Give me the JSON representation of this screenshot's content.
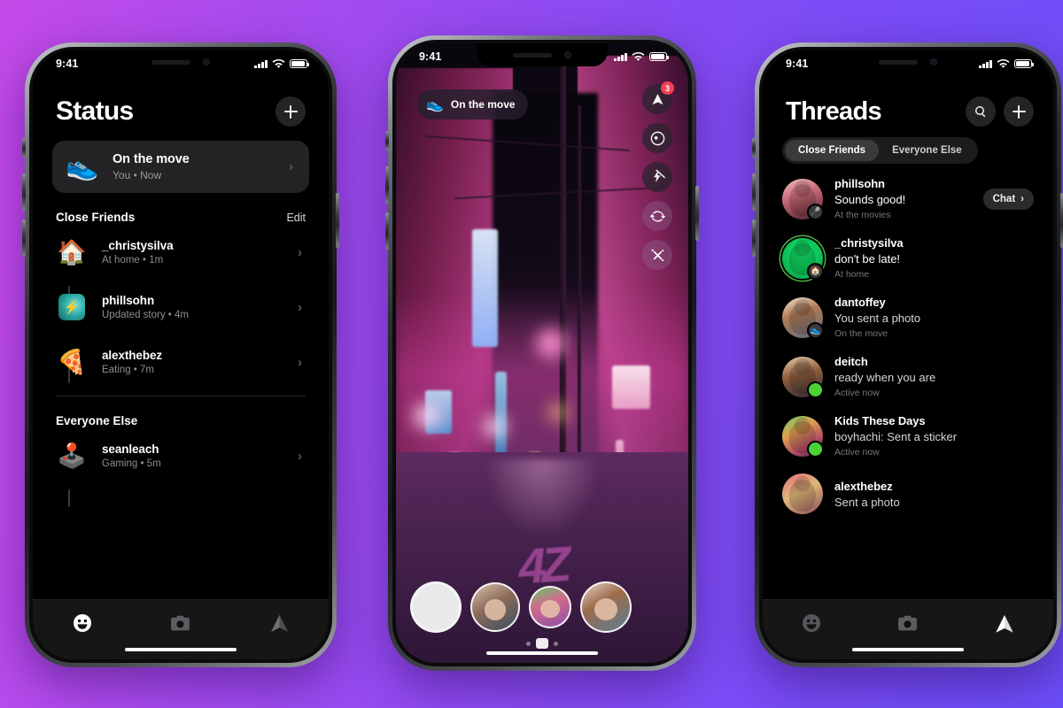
{
  "background": {
    "from": "#c44ae8",
    "to": "#6b4ef8"
  },
  "status_bar": {
    "time": "9:41"
  },
  "phone_status": {
    "title": "Status",
    "add_button": "+",
    "my_status": {
      "emoji": "👟",
      "title": "On the move",
      "subtitle": "You • Now",
      "chevron": "›"
    },
    "sections": [
      {
        "title": "Close Friends",
        "action": "Edit",
        "items": [
          {
            "emoji": "🏠",
            "name": "_christysilva",
            "meta": "At home • 1m",
            "chevron": "›"
          },
          {
            "emoji": "",
            "thumb": "story-thumb",
            "name": "phillsohn",
            "meta": "Updated story • 4m",
            "chevron": "›"
          },
          {
            "emoji": "🍕",
            "name": "alexthebez",
            "meta": "Eating • 7m",
            "chevron": "›"
          }
        ]
      },
      {
        "title": "Everyone Else",
        "action": "",
        "items": [
          {
            "emoji": "🕹️",
            "name": "seanleach",
            "meta": "Gaming • 5m",
            "chevron": "›"
          }
        ]
      }
    ],
    "tabs": [
      {
        "icon": "smiley-icon",
        "label": "Status",
        "active": true
      },
      {
        "icon": "camera-icon",
        "label": "Camera",
        "active": false
      },
      {
        "icon": "paper-plane-icon",
        "label": "Threads",
        "active": false
      }
    ]
  },
  "phone_camera": {
    "status_pill": {
      "emoji": "👟",
      "label": "On the move"
    },
    "controls": [
      {
        "icon": "paper-plane-icon",
        "name": "send",
        "badge": "3"
      },
      {
        "icon": "effects-icon",
        "name": "effects",
        "badge": ""
      },
      {
        "icon": "flash-off-icon",
        "name": "flash-off",
        "badge": ""
      },
      {
        "icon": "rotate-camera-icon",
        "name": "flip-camera",
        "badge": ""
      },
      {
        "icon": "magic-wand-icon",
        "name": "filters",
        "badge": ""
      }
    ],
    "shutter": "shutter-button",
    "friends": [
      "phillsohn",
      "kids-these-days",
      "dantoffey"
    ],
    "carousel_dots": 3,
    "carousel_active_index": 1,
    "scene": {
      "graffiti": "4Z"
    }
  },
  "phone_threads": {
    "title": "Threads",
    "search_button": "search-icon",
    "add_button": "+",
    "segments": [
      {
        "label": "Close Friends",
        "active": true
      },
      {
        "label": "Everyone Else",
        "active": false
      }
    ],
    "rows": [
      {
        "name": "phillsohn",
        "message": "Sounds good!",
        "sub": "At the movies",
        "avatar": "ph-a",
        "badge_emoji": "🎤",
        "badge_type": "emoji",
        "ring": false,
        "action": {
          "label": "Chat",
          "chevron": "›"
        }
      },
      {
        "name": "_christysilva",
        "message": "don't be late!",
        "sub": "At home",
        "avatar": "ph-b",
        "badge_emoji": "🏠",
        "badge_type": "emoji",
        "ring": true,
        "action": null
      },
      {
        "name": "dantoffey",
        "message": "You sent a photo",
        "sub": "On the move",
        "avatar": "ph-c",
        "badge_emoji": "👟",
        "badge_type": "emoji",
        "ring": false,
        "action": null
      },
      {
        "name": "deitch",
        "message": "ready when you are",
        "sub": "Active now",
        "avatar": "ph-d",
        "badge_emoji": "",
        "badge_type": "online",
        "ring": false,
        "action": null
      },
      {
        "name": "Kids These Days",
        "message": "boyhachi: Sent a sticker",
        "sub": "Active now",
        "avatar": "ph-e",
        "badge_emoji": "",
        "badge_type": "online",
        "ring": false,
        "action": null
      },
      {
        "name": "alexthebez",
        "message": "Sent a photo",
        "sub": "",
        "avatar": "ph-f",
        "badge_emoji": "",
        "badge_type": "none",
        "ring": false,
        "action": null
      }
    ],
    "tabs": [
      {
        "icon": "smiley-icon",
        "label": "Status",
        "active": false
      },
      {
        "icon": "camera-icon",
        "label": "Camera",
        "active": false
      },
      {
        "icon": "paper-plane-icon",
        "label": "Threads",
        "active": true
      }
    ]
  }
}
